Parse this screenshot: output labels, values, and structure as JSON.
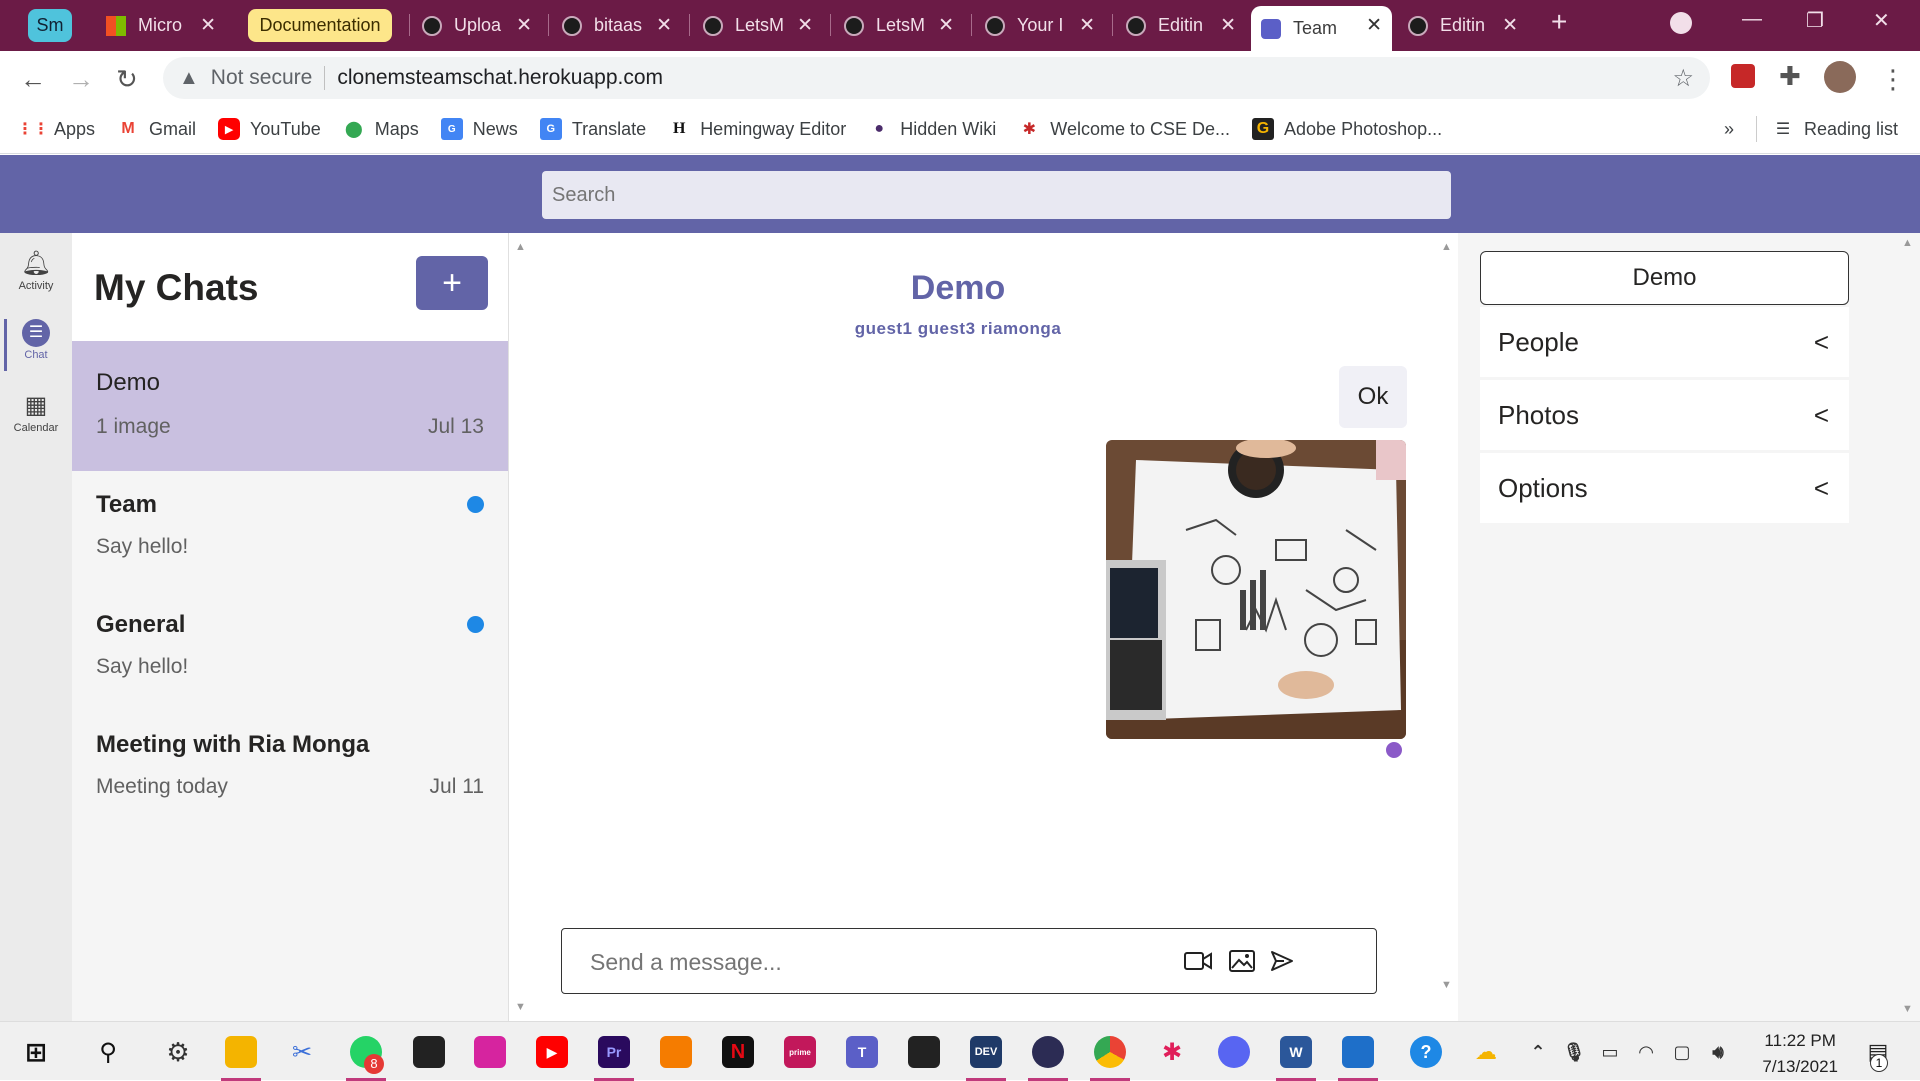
{
  "browser": {
    "tabs": [
      {
        "label": "Sm"
      },
      {
        "label": "Micro"
      },
      {
        "label": "Documentation"
      },
      {
        "label": "Uploa"
      },
      {
        "label": "bitaas"
      },
      {
        "label": "LetsM"
      },
      {
        "label": "LetsM"
      },
      {
        "label": "Your I"
      },
      {
        "label": "Editin"
      },
      {
        "label": "Team"
      },
      {
        "label": "Editin"
      }
    ],
    "security": "Not secure",
    "url": "clonemsteamschat.herokuapp.com",
    "bookmarks": [
      {
        "label": "Apps"
      },
      {
        "label": "Gmail"
      },
      {
        "label": "YouTube"
      },
      {
        "label": "Maps"
      },
      {
        "label": "News"
      },
      {
        "label": "Translate"
      },
      {
        "label": "Hemingway Editor"
      },
      {
        "label": "Hidden Wiki"
      },
      {
        "label": "Welcome to CSE De..."
      },
      {
        "label": "Adobe Photoshop..."
      }
    ],
    "overflow": "»",
    "reading_list": "Reading list"
  },
  "app": {
    "search_placeholder": "Search",
    "rail": [
      {
        "label": "Activity"
      },
      {
        "label": "Chat"
      },
      {
        "label": "Calendar"
      }
    ],
    "chat_list": {
      "title": "My Chats",
      "add_label": "+",
      "items": [
        {
          "name": "Demo",
          "preview": "1 image",
          "date": "Jul 13"
        },
        {
          "name": "Team",
          "preview": "Say hello!",
          "date": ""
        },
        {
          "name": "General",
          "preview": "Say hello!",
          "date": ""
        },
        {
          "name": "Meeting with Ria Monga",
          "preview": "Meeting today",
          "date": "Jul 11"
        }
      ]
    },
    "conversation": {
      "title": "Demo",
      "members": "guest1 guest3 riamonga",
      "messages": [
        {
          "text": "Ok"
        }
      ],
      "composer_placeholder": "Send a message..."
    },
    "details": {
      "title": "Demo",
      "sections": [
        {
          "label": "People"
        },
        {
          "label": "Photos"
        },
        {
          "label": "Options"
        }
      ],
      "chevron": "<"
    }
  },
  "taskbar": {
    "time": "11:22 PM",
    "date": "7/13/2021",
    "whatsapp_badge": "8",
    "notification_count": "1"
  }
}
